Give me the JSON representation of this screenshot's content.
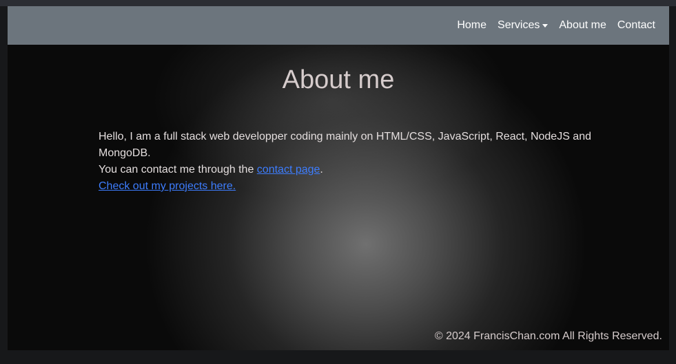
{
  "nav": {
    "items": [
      {
        "label": "Home"
      },
      {
        "label": "Services",
        "dropdown": true
      },
      {
        "label": "About me"
      },
      {
        "label": "Contact"
      }
    ],
    "background": "#6c757d"
  },
  "main": {
    "title": "About me",
    "intro": "Hello, I am a full stack web developper coding mainly on HTML/CSS, JavaScript, React, NodeJS and MongoDB.",
    "contact_prefix": "You can contact me through the ",
    "contact_link": "contact page",
    "contact_suffix": ".",
    "projects_link": "Check out my projects here.",
    "link_color": "#3d7dfe"
  },
  "footer": {
    "text": "© 2024 FrancisChan.com All Rights Reserved."
  }
}
